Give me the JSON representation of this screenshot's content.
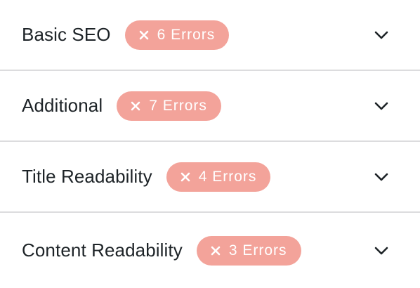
{
  "sections": [
    {
      "title": "Basic SEO",
      "badge": "6 Errors",
      "badge_icon": "close-icon",
      "toggle_icon": "chevron-down-icon"
    },
    {
      "title": "Additional",
      "badge": "7 Errors",
      "badge_icon": "close-icon",
      "toggle_icon": "chevron-down-icon"
    },
    {
      "title": "Title Readability",
      "badge": "4 Errors",
      "badge_icon": "close-icon",
      "toggle_icon": "chevron-down-icon"
    },
    {
      "title": "Content Readability",
      "badge": "3 Errors",
      "badge_icon": "close-icon",
      "toggle_icon": "chevron-down-icon"
    }
  ],
  "colors": {
    "badge_background": "#f3a39a",
    "badge_text": "#ffffff",
    "title_text": "#1d2327",
    "divider": "#dcdcde"
  }
}
